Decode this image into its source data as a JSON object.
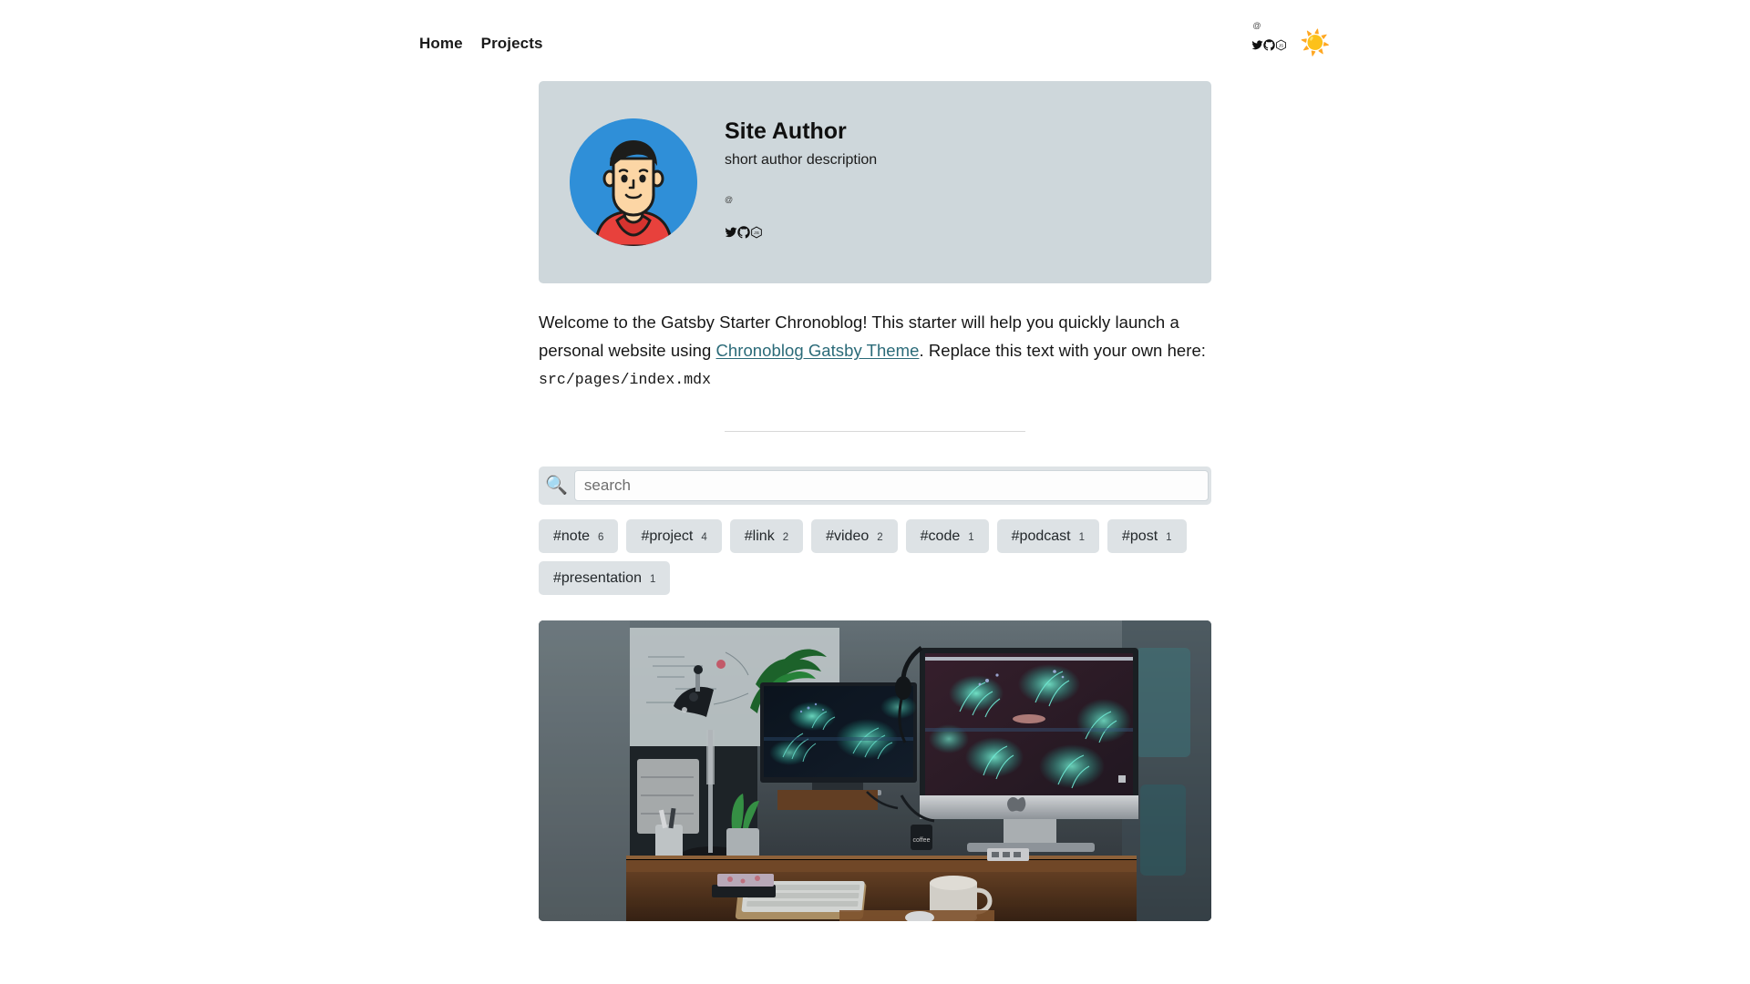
{
  "header": {
    "nav": [
      {
        "label": "Home",
        "name": "nav-link-home"
      },
      {
        "label": "Projects",
        "name": "nav-link-projects"
      }
    ],
    "at_symbol": "@",
    "social": [
      {
        "name": "twitter-icon",
        "label": "Twitter"
      },
      {
        "name": "github-icon",
        "label": "GitHub"
      },
      {
        "name": "npm-js-icon",
        "label": "JS"
      }
    ],
    "theme_toggle": "☀️",
    "theme_toggle_name": "sun-icon"
  },
  "author": {
    "name": "Site Author",
    "description": "short author description",
    "at_symbol": "@",
    "avatar_alt": "cartoon avatar of a person with black hair in a red hoodie",
    "social": [
      {
        "name": "twitter-icon",
        "label": "Twitter"
      },
      {
        "name": "github-icon",
        "label": "GitHub"
      },
      {
        "name": "npm-js-icon",
        "label": "JS"
      }
    ],
    "card_background": "#ced7db"
  },
  "intro": {
    "part1": "Welcome to the Gatsby Starter Chronoblog! This starter will help you quickly launch a personal website using ",
    "link_text": "Chronoblog Gatsby Theme",
    "part2": ". Replace this text with your own here: ",
    "code": "src/pages/index.mdx",
    "link_color": "#2a6a78"
  },
  "search": {
    "icon": "🔍",
    "placeholder": "search",
    "value": ""
  },
  "tags": [
    {
      "label": "#note",
      "count": "6"
    },
    {
      "label": "#project",
      "count": "4"
    },
    {
      "label": "#link",
      "count": "2"
    },
    {
      "label": "#video",
      "count": "2"
    },
    {
      "label": "#code",
      "count": "1"
    },
    {
      "label": "#podcast",
      "count": "1"
    },
    {
      "label": "#post",
      "count": "1"
    },
    {
      "label": "#presentation",
      "count": "1"
    }
  ],
  "feature": {
    "alt": "desk workspace with two monitors showing teal coral wallpaper, desk lamp, plants, keyboard and mug"
  }
}
